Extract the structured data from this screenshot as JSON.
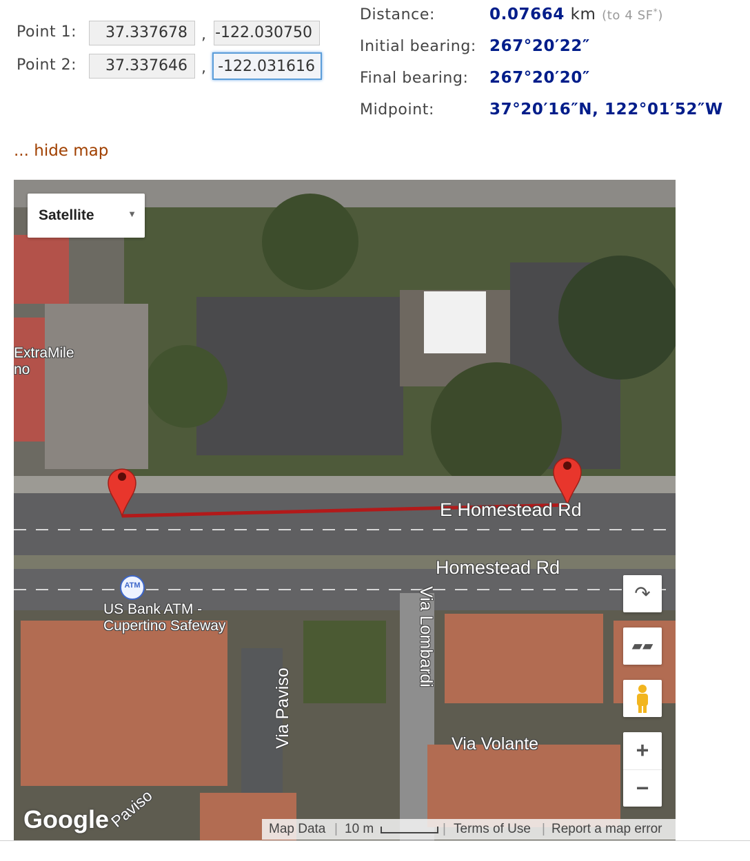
{
  "inputs": {
    "point1_label": "Point 1:",
    "point2_label": "Point 2:",
    "p1_lat": "37.337678",
    "p1_lon": "-122.030750",
    "p2_lat": "37.337646",
    "p2_lon": "-122.031616",
    "comma": ","
  },
  "results": {
    "distance_label": "Distance:",
    "distance_value": "0.07664",
    "distance_unit": "km",
    "distance_note": "(to 4 SF",
    "distance_note_sup": "*",
    "distance_note_close": ")",
    "initial_bearing_label": "Initial bearing:",
    "initial_bearing_value": "267°20′22″",
    "final_bearing_label": "Final bearing:",
    "final_bearing_value": "267°20′20″",
    "midpoint_label": "Midpoint:",
    "midpoint_value": "37°20′16″N, 122°01′52″W"
  },
  "hide_map_link": "... hide map",
  "map": {
    "map_type": "Satellite",
    "labels": {
      "e_homestead": "E Homestead Rd",
      "homestead": "Homestead Rd",
      "via_lombardi": "Via Lombardi",
      "via_paviso": "Via Paviso",
      "via_volante": "Via Volante",
      "paviso_partial": "Paviso",
      "atm": "US Bank ATM -",
      "atm2": "Cupertino Safeway",
      "atm_badge": "ATM",
      "extramile": "ExtraMile",
      "extramile2": "no"
    },
    "logo": "Google",
    "footer": {
      "map_data": "Map Data",
      "scale": "10 m",
      "terms": "Terms of Use",
      "report": "Report a map error"
    },
    "zoom_in": "+",
    "zoom_out": "−",
    "colors": {
      "route": "#b21a1a",
      "marker": "#e8362c"
    }
  }
}
